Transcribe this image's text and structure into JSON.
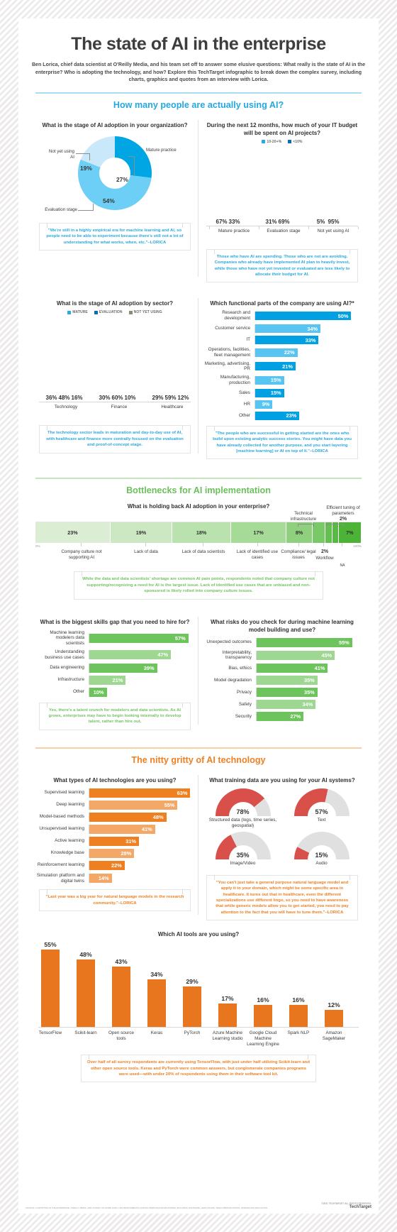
{
  "header": {
    "title": "The state of AI in the enterprise",
    "subtitle": "Ben Lorica, chief data scientist at O'Reilly Media, and his team set off to answer some elusive questions: What really is the state of AI in the enterprise? Who is adopting the technology, and how? Explore this TechTarget infographic to break down the complex survey, including charts, graphics and quotes from an interview with Lorica."
  },
  "sections": {
    "using": "How many people are actually using AI?",
    "bottlenecks": "Bottlenecks for AI implementation",
    "nitty": "The nitty gritty of AI technology"
  },
  "charts": {
    "adoption_stage": {
      "type": "pie",
      "title": "What is the stage of AI adoption in your organization?",
      "categories": [
        "Mature practice",
        "Evaluation stage",
        "Not yet using AI"
      ],
      "values": [
        27,
        54,
        19
      ],
      "labels": [
        "27%",
        "54%",
        "19%"
      ],
      "colors": [
        "#00a5e3",
        "#6ecff6",
        "#c9e9fa"
      ]
    },
    "budget": {
      "type": "bar",
      "title": "During the next 12 months, how much of your IT budget will be spent on AI projects?",
      "legend": [
        "10-20+%",
        "<10%"
      ],
      "legend_colors": [
        "#29abe2",
        "#0d6ead"
      ],
      "categories": [
        "Mature practice",
        "Evaluation stage",
        "Not yet using AI"
      ],
      "series": [
        {
          "name": "10-20+%",
          "values": [
            67,
            31,
            5
          ],
          "labels": [
            "67%",
            "31%",
            "5%"
          ]
        },
        {
          "name": "<10%",
          "values": [
            33,
            69,
            95
          ],
          "labels": [
            "33%",
            "69%",
            "95%"
          ]
        }
      ],
      "ylim": [
        0,
        100
      ]
    },
    "sector": {
      "type": "bar",
      "title": "What is the stage of AI adoption by sector?",
      "legend": [
        "MATURE",
        "EVALUATION",
        "NOT YET USING"
      ],
      "legend_colors": [
        "#29abe2",
        "#0d6ead",
        "#8a8a7c"
      ],
      "categories": [
        "Technology",
        "Finance",
        "Healthcare"
      ],
      "series": [
        {
          "name": "MATURE",
          "values": [
            36,
            30,
            29
          ],
          "labels": [
            "36%",
            "30%",
            "29%"
          ]
        },
        {
          "name": "EVALUATION",
          "values": [
            48,
            60,
            59
          ],
          "labels": [
            "48%",
            "60%",
            "59%"
          ]
        },
        {
          "name": "NOT YET USING",
          "values": [
            16,
            10,
            12
          ],
          "labels": [
            "16%",
            "10%",
            "12%"
          ]
        }
      ],
      "ylim": [
        0,
        70
      ]
    },
    "functional": {
      "type": "bar",
      "title": "Which functional parts of the company are using AI?*",
      "categories": [
        "Research and development",
        "Customer service",
        "IT",
        "Operations, facilities, fleet management",
        "Marketing, advertising, PR",
        "Manufacturing, production",
        "Sales",
        "HR",
        "Other"
      ],
      "values": [
        50,
        34,
        33,
        22,
        21,
        15,
        15,
        9,
        23
      ],
      "labels": [
        "50%",
        "34%",
        "33%",
        "22%",
        "21%",
        "15%",
        "15%",
        "9%",
        "23%"
      ],
      "colors": [
        "#00a0e2",
        "#57c4f2",
        "#00a0e2",
        "#57c4f2",
        "#00a0e2",
        "#57c4f2",
        "#00a0e2",
        "#57c4f2",
        "#00a0e2"
      ],
      "ylim": [
        0,
        55
      ]
    },
    "holding_back": {
      "type": "bar",
      "title": "What is holding back AI adoption in your enterprise?",
      "categories": [
        "Company culture not supporting AI",
        "Lack of data",
        "Lack of data scientists",
        "Lack of identified use cases",
        "Compliance/ legal issues",
        "Technical infrastructure",
        "Workflow",
        "Efficient tuning of parameters",
        "NA"
      ],
      "values": [
        23,
        19,
        18,
        17,
        8,
        4,
        2,
        2,
        7
      ],
      "labels": [
        "23%",
        "19%",
        "18%",
        "17%",
        "8%",
        "4%",
        "2%",
        "2%",
        "7%"
      ],
      "colors": [
        "#dbeed4",
        "#cbe8c2",
        "#bae2ae",
        "#a6da97",
        "#8ed07d",
        "#7ac968",
        "#63bf4f",
        "#57ba42",
        "#4cb337"
      ],
      "axis_start": "0%",
      "axis_end": "100%"
    },
    "skills_gap": {
      "type": "bar",
      "title": "What is the biggest skills gap that you need to hire for?",
      "categories": [
        "Machine learning modelers data scientists",
        "Understanding business use cases",
        "Data engineering",
        "Infrastructure",
        "Other"
      ],
      "values": [
        57,
        47,
        39,
        21,
        10
      ],
      "labels": [
        "57%",
        "47%",
        "39%",
        "21%",
        "10%"
      ],
      "colors": [
        "#6dc45c",
        "#9ed792",
        "#6dc45c",
        "#9ed792",
        "#6dc45c"
      ],
      "ylim": [
        0,
        60
      ]
    },
    "risks": {
      "type": "bar",
      "title": "What risks do you check for during machine learning model building and use?",
      "categories": [
        "Unexpected outcomes",
        "Interpretability, transparency",
        "Bias, ethics",
        "Model degradation",
        "Privacy",
        "Safety",
        "Security"
      ],
      "values": [
        55,
        45,
        41,
        35,
        35,
        34,
        27
      ],
      "labels": [
        "55%",
        "45%",
        "41%",
        "35%",
        "35%",
        "34%",
        "27%"
      ],
      "colors": [
        "#6dc45c",
        "#9ed792",
        "#6dc45c",
        "#9ed792",
        "#6dc45c",
        "#9ed792",
        "#6dc45c"
      ],
      "ylim": [
        0,
        60
      ]
    },
    "tech_types": {
      "type": "bar",
      "title": "What types of AI technologies are you using?",
      "categories": [
        "Supervised learning",
        "Deep learning",
        "Model-based methods",
        "Unsupervised learning",
        "Active learning",
        "Knowledge base",
        "Reinforcement learning",
        "Simulation platform and digital twins"
      ],
      "values": [
        63,
        55,
        48,
        41,
        31,
        28,
        22,
        14
      ],
      "labels": [
        "63%",
        "55%",
        "48%",
        "41%",
        "31%",
        "28%",
        "22%",
        "14%"
      ],
      "colors": [
        "#ef8022",
        "#f3a868",
        "#ef8022",
        "#f3a868",
        "#ef8022",
        "#f3a868",
        "#ef8022",
        "#f3a868"
      ],
      "ylim": [
        0,
        65
      ]
    },
    "training_data": {
      "type": "pie",
      "title": "What training data are you using for your AI systems?",
      "categories": [
        "Structured data (logs, time series, geospatial)",
        "Text",
        "Image/Video",
        "Audio"
      ],
      "values": [
        78,
        57,
        35,
        15
      ],
      "labels": [
        "78%",
        "57%",
        "35%",
        "15%"
      ],
      "colors": [
        "#d9504a",
        "#e0e0e0"
      ]
    },
    "tools": {
      "type": "bar",
      "title": "Which AI tools are you using?",
      "categories": [
        "TensorFlow",
        "Scikit-learn",
        "Open source tools",
        "Keras",
        "PyTorch",
        "Azure Machine Learning studio",
        "Google Cloud Machine Learning Engine",
        "Spark NLP",
        "Amazon SageMaker"
      ],
      "values": [
        55,
        48,
        43,
        34,
        29,
        17,
        16,
        16,
        12
      ],
      "labels": [
        "55%",
        "48%",
        "43%",
        "34%",
        "29%",
        "17%",
        "16%",
        "16%",
        "12%"
      ],
      "colors": [
        "#e8761f",
        "#e8761f",
        "#e8761f",
        "#e8761f",
        "#e8761f",
        "#e8761f",
        "#e8761f",
        "#e8761f",
        "#e8761f"
      ],
      "ylim": [
        0,
        60
      ]
    }
  },
  "quotes": {
    "q1": "\"We're still in a highly empirical era for machine learning and AI, so people need to be able to experiment because there's still not a lot of understanding for what works, when, etc.\"–LORICA",
    "q2": "Those who have AI are spending. Those who are not are avoiding. Companies who already have implemented AI plan to heavily invest, while those who have not yet invested or evaluated are less likely to allocate their budget for AI.",
    "q3": "The technology sector leads in maturation and day-to-day use of AI, with healthcare and finance more centrally focused on the evaluation and proof-of-concept stage.",
    "q4": "\"The people who are successful in getting started are the ones who build upon existing analytic success stories. You might have data you have already collected for another purpose, and you start layering [machine learning] or AI on top of it.\"–LORICA",
    "q5": "While the data and data scientists' shortage are common AI pain points, respondents noted that company culture not supporting/recognizing a need for AI is the largest issue. Lack of identified use cases that are unbiased and non-sponsored is likely rolled into company culture issues.",
    "q6": "Yes, there's a talent crunch for modelers and data scientists. As AI grows, enterprises may have to begin looking internally to develop talent, rather than hire out.",
    "q7": "\"Last year was a big year for natural language models in the research community.\"–LORICA",
    "q8": "\"You can't just take a general purpose natural language model and apply it to your domain, which might be some specific area in healthcare. It turns out that in healthcare, even the different specializations use different lingo, so you need to have awareness that while generic models allow you to get started, you need to pay attention to the fact that you will have to tune them.\"–LORICA",
    "q9": "Over half of all survey respondents are currently using TensorFlow, with just under half utilizing Scikit-learn and other open source tools. Keras and PyTorch were common answers, but conglomerate companies programs were used—with under 20% of respondents using them in their software tool kit."
  },
  "footer": {
    "left": "SOURCE: AI ADOPTION IN THE ENTERPRISE, O'REILLY MEDIA, 2020 SURVEY OF MORE THAN 1,300 RESPONDENTS ACROSS FIRMS MAJOR INDUSTRIES INCLUDING SOFTWARE, HEALTHCARE, TELECOMMUNICATIONS, FINANCE AND EDUCATION.",
    "right": "©2021 TECHTARGET. ALL RIGHTS RESERVED.",
    "brand": "TechTarget"
  }
}
